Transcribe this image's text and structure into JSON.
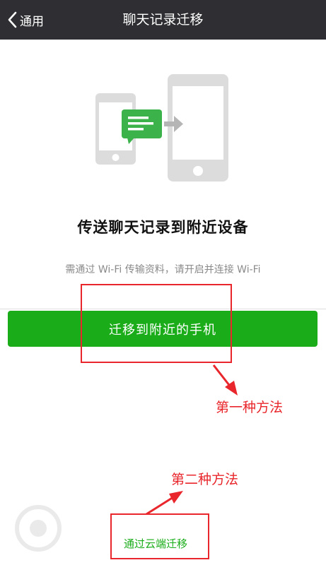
{
  "navbar": {
    "back_label": "通用",
    "title": "聊天记录迁移"
  },
  "illustration": {
    "phone_color": "#dcdcdc",
    "bubble_color": "#3cb34a",
    "arrow_color": "#b5b5b5"
  },
  "main": {
    "headline": "传送聊天记录到附近设备",
    "subtext": "需通过 Wi-Fi 传输资料，请开启并连接 Wi-Fi",
    "primary_button": "迁移到附近的手机",
    "cloud_link": "通过云端迁移"
  },
  "annotations": {
    "first_method": "第一种方法",
    "second_method": "第二种方法"
  },
  "colors": {
    "navbar": "#2e2e33",
    "primary": "#1aad19",
    "annotation": "#e8262b"
  }
}
